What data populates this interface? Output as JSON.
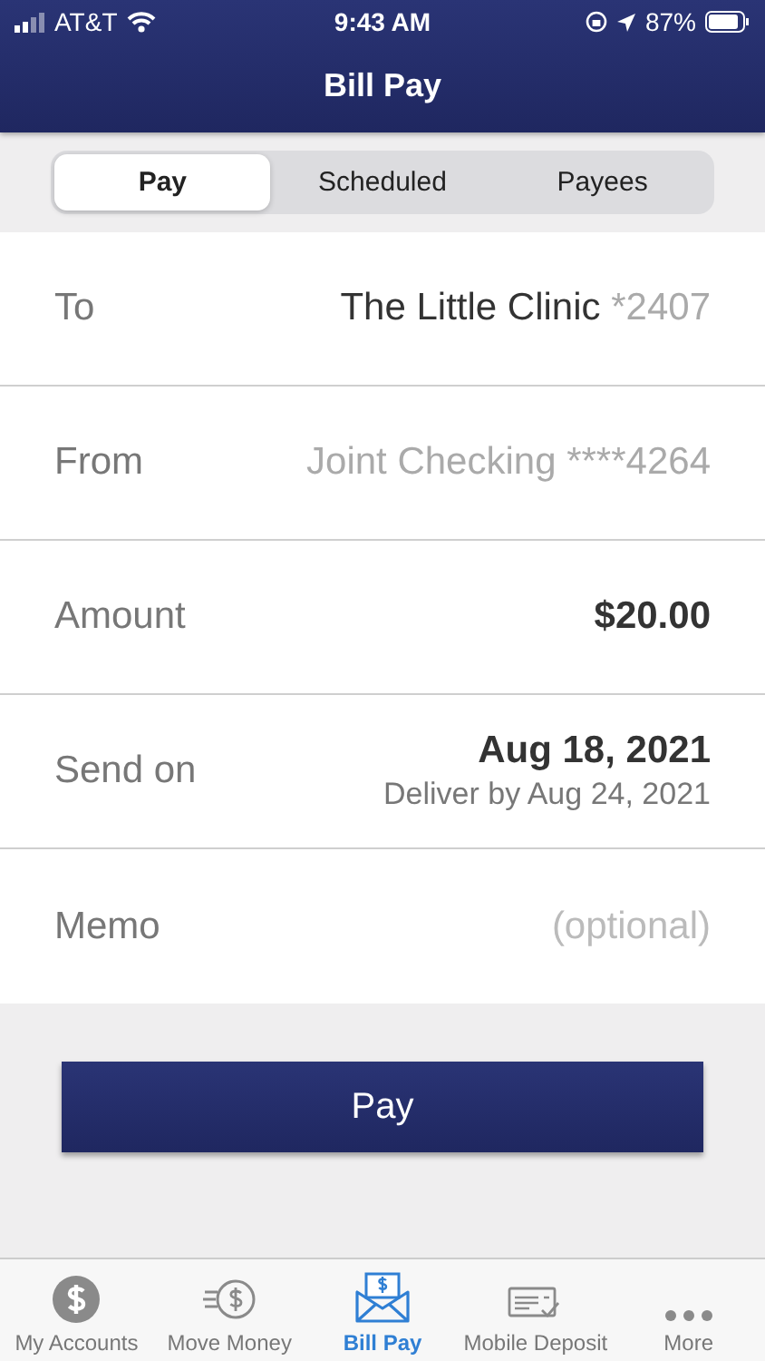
{
  "status_bar": {
    "carrier": "AT&T",
    "time": "9:43 AM",
    "battery": "87%"
  },
  "header": {
    "title": "Bill Pay"
  },
  "segments": [
    {
      "label": "Pay",
      "selected": true
    },
    {
      "label": "Scheduled",
      "selected": false
    },
    {
      "label": "Payees",
      "selected": false
    }
  ],
  "form": [
    {
      "kind": "payee",
      "label": "To",
      "value": "The Little Clinic",
      "suffix": "*2407"
    },
    {
      "kind": "account",
      "label": "From",
      "value": "Joint Checking ****4264",
      "muted": true
    },
    {
      "kind": "amount",
      "label": "Amount",
      "value": "$20.00"
    },
    {
      "kind": "date",
      "label": "Send on",
      "value": "Aug 18, 2021",
      "note": "Deliver by Aug 24, 2021"
    },
    {
      "kind": "memo",
      "label": "Memo",
      "placeholder": "(optional)"
    }
  ],
  "submit": "Pay",
  "tab_bar": [
    {
      "kind": "accounts",
      "label": "My Accounts",
      "selected": false
    },
    {
      "kind": "transfer",
      "label": "Move Money",
      "selected": false
    },
    {
      "kind": "billpay",
      "label": "Bill Pay",
      "selected": true
    },
    {
      "kind": "deposit",
      "label": "Mobile Deposit",
      "selected": false
    },
    {
      "kind": "more",
      "label": "More",
      "selected": false
    }
  ]
}
